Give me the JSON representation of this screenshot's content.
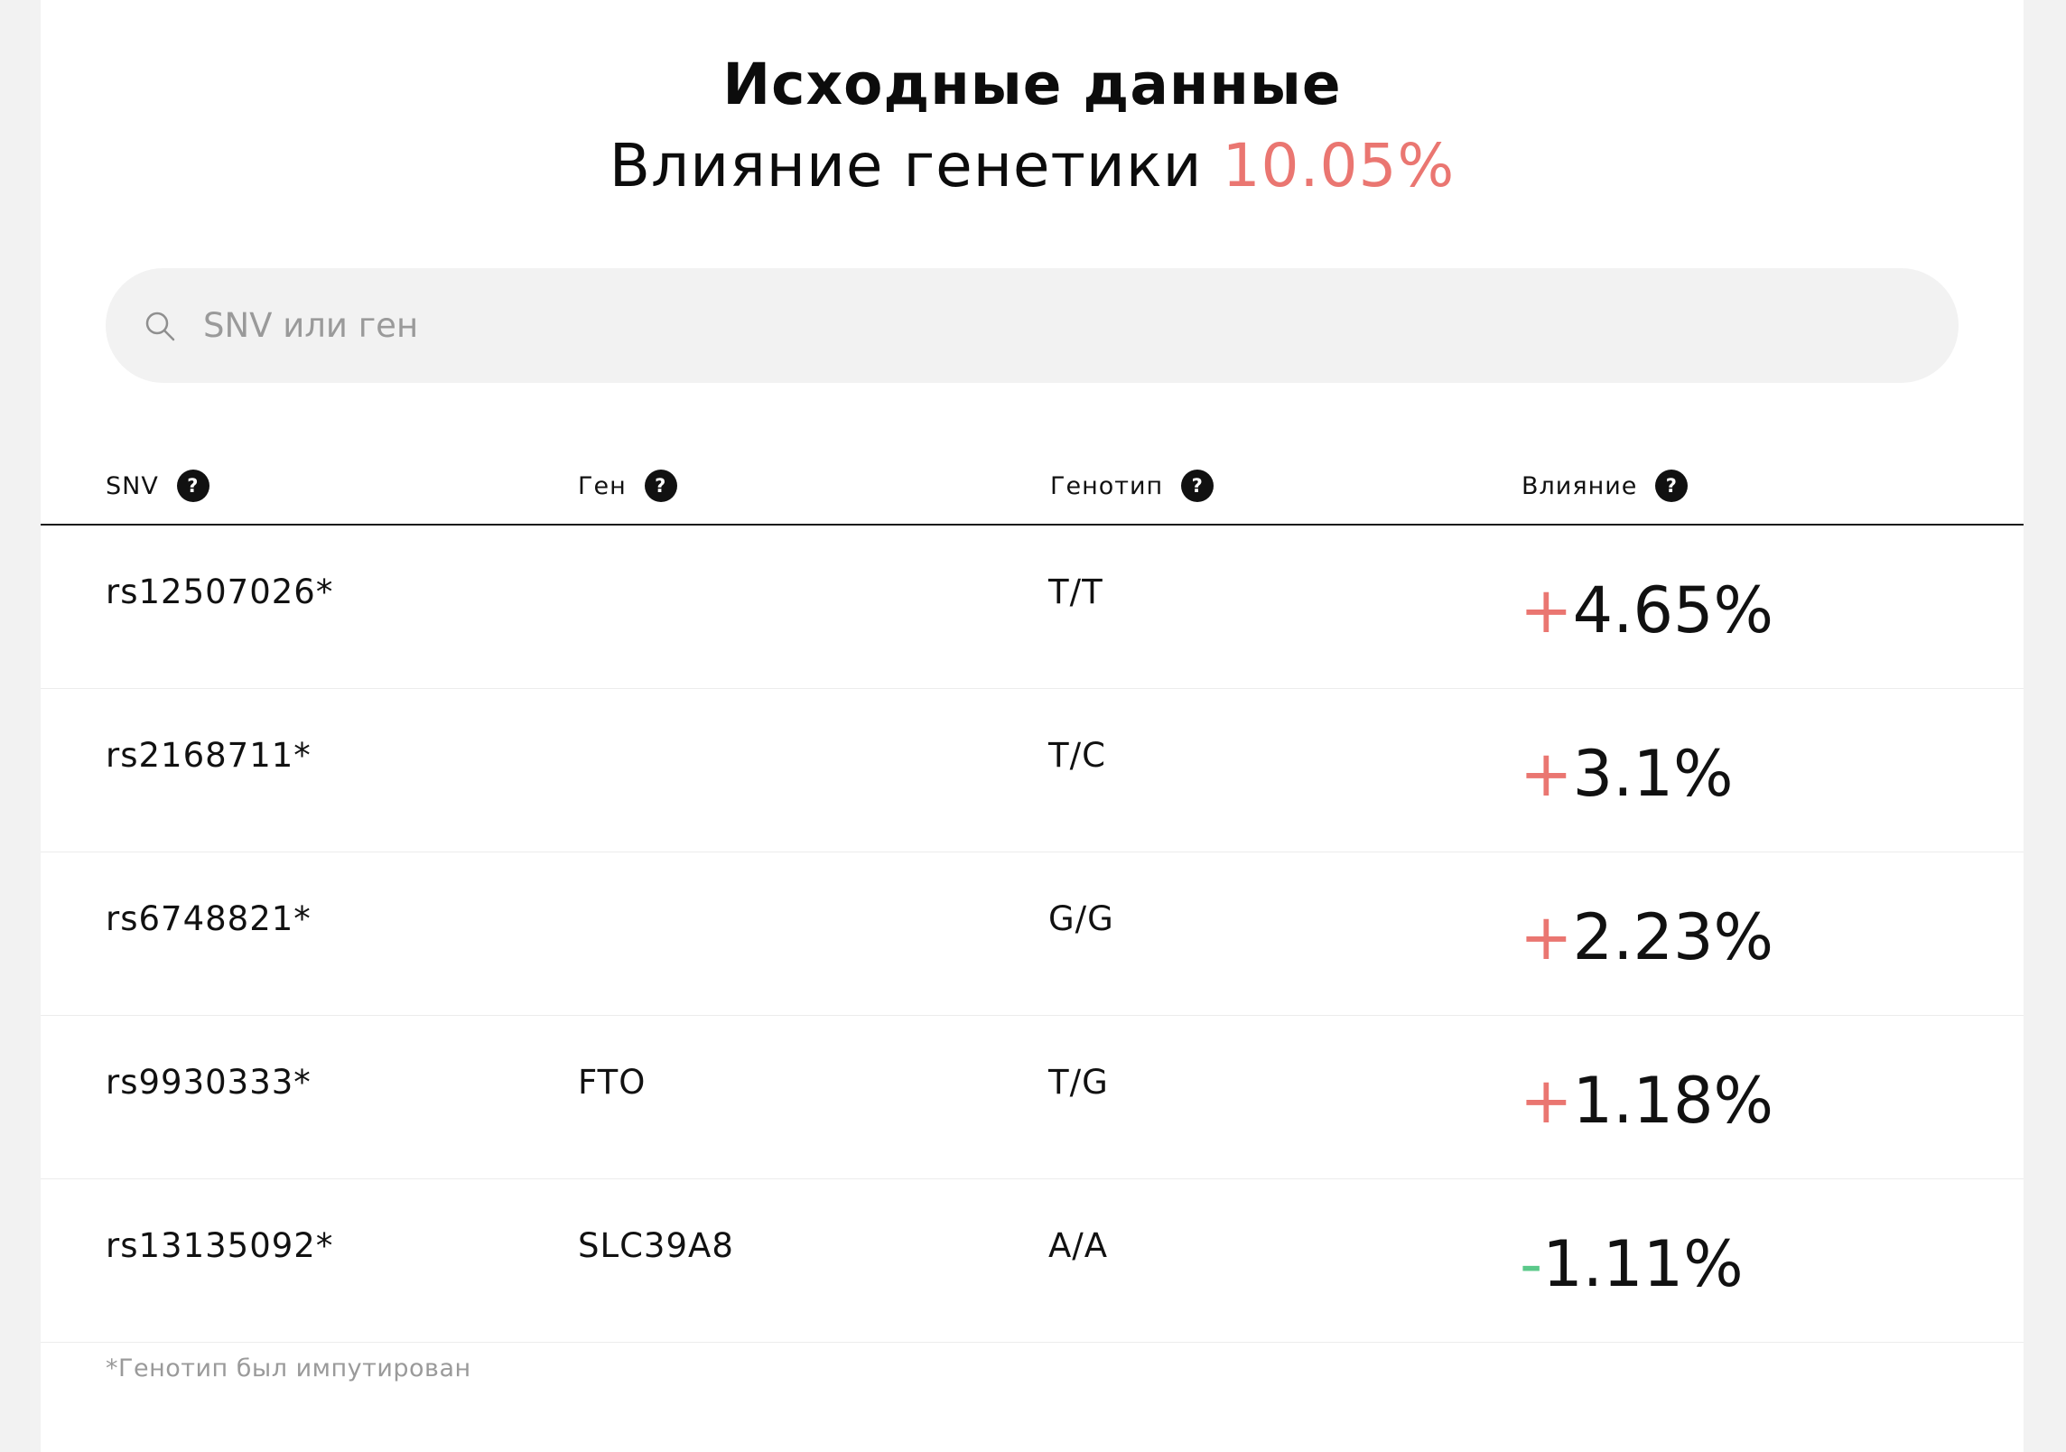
{
  "header": {
    "title": "Исходные данные",
    "subtitle_prefix": "Влияние генетики",
    "subtitle_value": "10.05%"
  },
  "search": {
    "placeholder": "SNV или ген",
    "value": "",
    "icon": "search-icon"
  },
  "table": {
    "columns": [
      {
        "label": "SNV",
        "help": "?"
      },
      {
        "label": "Ген",
        "help": "?"
      },
      {
        "label": "Генотип",
        "help": "?"
      },
      {
        "label": "Влияние",
        "help": "?"
      }
    ],
    "rows": [
      {
        "snv": "rs12507026*",
        "gene": "",
        "genotype": "T/T",
        "sign": "+",
        "impact": "4.65%"
      },
      {
        "snv": "rs2168711*",
        "gene": "",
        "genotype": "T/C",
        "sign": "+",
        "impact": "3.1%"
      },
      {
        "snv": "rs6748821*",
        "gene": "",
        "genotype": "G/G",
        "sign": "+",
        "impact": "2.23%"
      },
      {
        "snv": "rs9930333*",
        "gene": "FTO",
        "genotype": "T/G",
        "sign": "+",
        "impact": "1.18%"
      },
      {
        "snv": "rs13135092*",
        "gene": "SLC39A8",
        "genotype": "A/A",
        "sign": "-",
        "impact": "1.11%"
      }
    ]
  },
  "footnote": "*Генотип был импутирован",
  "colors": {
    "accent": "#ea7671",
    "positive_sign": "#ea7671",
    "negative_sign": "#5bc98a",
    "background": "#f2f2f2"
  }
}
